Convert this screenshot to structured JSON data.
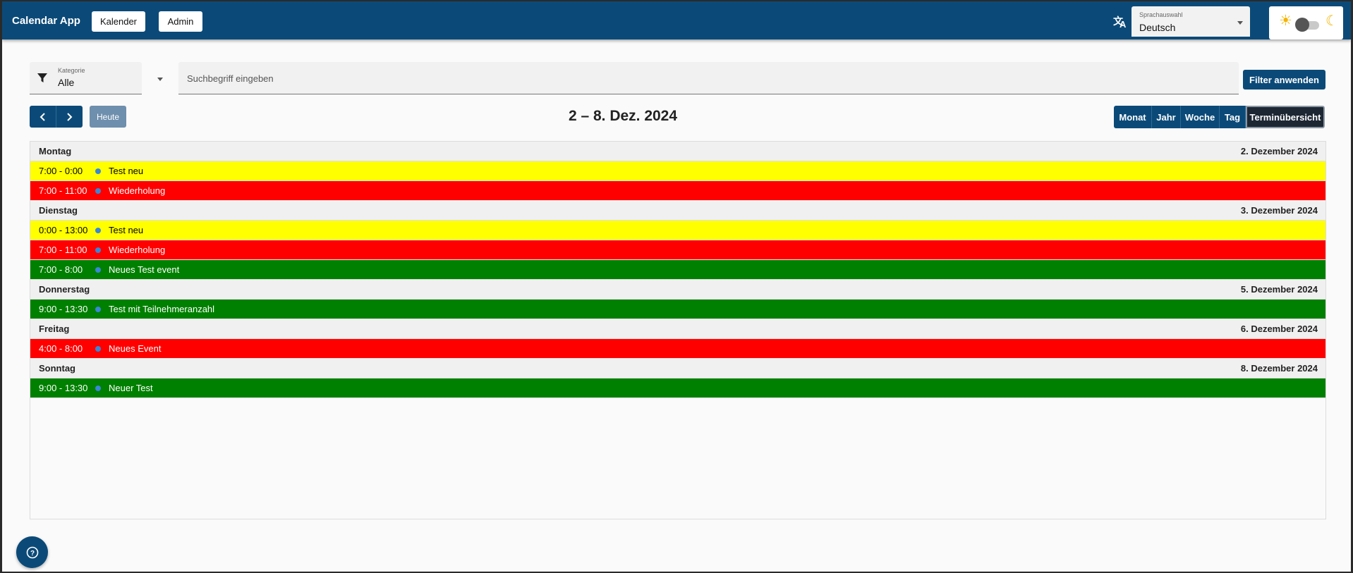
{
  "header": {
    "app_title": "Calendar App",
    "nav": [
      {
        "label": "Kalender"
      },
      {
        "label": "Admin"
      }
    ],
    "language": {
      "label": "Sprachauswahl",
      "value": "Deutsch"
    },
    "theme_toggle": {
      "dark_mode": false
    }
  },
  "filters": {
    "category_label": "Kategorie",
    "category_value": "Alle",
    "search_placeholder": "Suchbegriff eingeben",
    "search_value": "",
    "apply_label": "Filter anwenden"
  },
  "toolbar": {
    "today_label": "Heute",
    "range_title": "2 – 8. Dez. 2024",
    "views": [
      {
        "label": "Monat",
        "active": false
      },
      {
        "label": "Jahr",
        "active": false
      },
      {
        "label": "Woche",
        "active": false
      },
      {
        "label": "Tag",
        "active": false
      },
      {
        "label": "Terminübersicht",
        "active": true
      }
    ]
  },
  "colors": {
    "primary": "#0b4a78",
    "yellow_event": "#ffff00",
    "red_event": "#ff0000",
    "green_event": "#008000",
    "event_dot": "#3a87d6"
  },
  "agenda": [
    {
      "weekday": "Montag",
      "date": "2. Dezember 2024",
      "events": [
        {
          "time": "7:00 - 0:00",
          "title": "Test neu",
          "color": "#ffff00",
          "text_color": "#000000"
        },
        {
          "time": "7:00 - 11:00",
          "title": "Wiederholung",
          "color": "#ff0000",
          "text_color": "#ffffff"
        }
      ]
    },
    {
      "weekday": "Dienstag",
      "date": "3. Dezember 2024",
      "events": [
        {
          "time": "0:00 - 13:00",
          "title": "Test neu",
          "color": "#ffff00",
          "text_color": "#000000"
        },
        {
          "time": "7:00 - 11:00",
          "title": "Wiederholung",
          "color": "#ff0000",
          "text_color": "#ffffff"
        },
        {
          "time": "7:00 - 8:00",
          "title": "Neues Test event",
          "color": "#008000",
          "text_color": "#ffffff"
        }
      ]
    },
    {
      "weekday": "Donnerstag",
      "date": "5. Dezember 2024",
      "events": [
        {
          "time": "9:00 - 13:30",
          "title": "Test mit Teilnehmeranzahl",
          "color": "#008000",
          "text_color": "#ffffff"
        }
      ]
    },
    {
      "weekday": "Freitag",
      "date": "6. Dezember 2024",
      "events": [
        {
          "time": "4:00 - 8:00",
          "title": "Neues Event",
          "color": "#ff0000",
          "text_color": "#ffffff"
        }
      ]
    },
    {
      "weekday": "Sonntag",
      "date": "8. Dezember 2024",
      "events": [
        {
          "time": "9:00 - 13:30",
          "title": "Neuer Test",
          "color": "#008000",
          "text_color": "#ffffff"
        }
      ]
    }
  ]
}
